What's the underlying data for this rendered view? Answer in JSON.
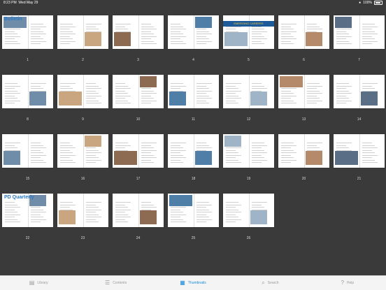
{
  "status_bar": {
    "time": "8:23 PM",
    "date": "Wed May 29",
    "battery": "100%"
  },
  "pages": [
    {
      "number": "1",
      "title": "Bulletin"
    },
    {
      "number": "2"
    },
    {
      "number": "3"
    },
    {
      "number": "4"
    },
    {
      "number": "5",
      "banner": "EMERGING CAREERS"
    },
    {
      "number": "6"
    },
    {
      "number": "7"
    },
    {
      "number": "8"
    },
    {
      "number": "9"
    },
    {
      "number": "10"
    },
    {
      "number": "11"
    },
    {
      "number": "12"
    },
    {
      "number": "13"
    },
    {
      "number": "14"
    },
    {
      "number": "15"
    },
    {
      "number": "16"
    },
    {
      "number": "17"
    },
    {
      "number": "18"
    },
    {
      "number": "19"
    },
    {
      "number": "20"
    },
    {
      "number": "21"
    },
    {
      "number": "22",
      "title": "PD Quarterly"
    },
    {
      "number": "23"
    },
    {
      "number": "24"
    },
    {
      "number": "25"
    },
    {
      "number": "26"
    }
  ],
  "tabs": [
    {
      "label": "Library",
      "icon": "folder-icon",
      "active": false
    },
    {
      "label": "Contents",
      "icon": "document-icon",
      "active": false
    },
    {
      "label": "Thumbnails",
      "icon": "grid-icon",
      "active": true
    },
    {
      "label": "Search",
      "icon": "search-icon",
      "active": false
    },
    {
      "label": "Help",
      "icon": "help-icon",
      "active": false
    }
  ],
  "colors": {
    "accent": "#1a8ad6",
    "background": "#3a3a3a",
    "tab_inactive": "#9a9a9a"
  }
}
